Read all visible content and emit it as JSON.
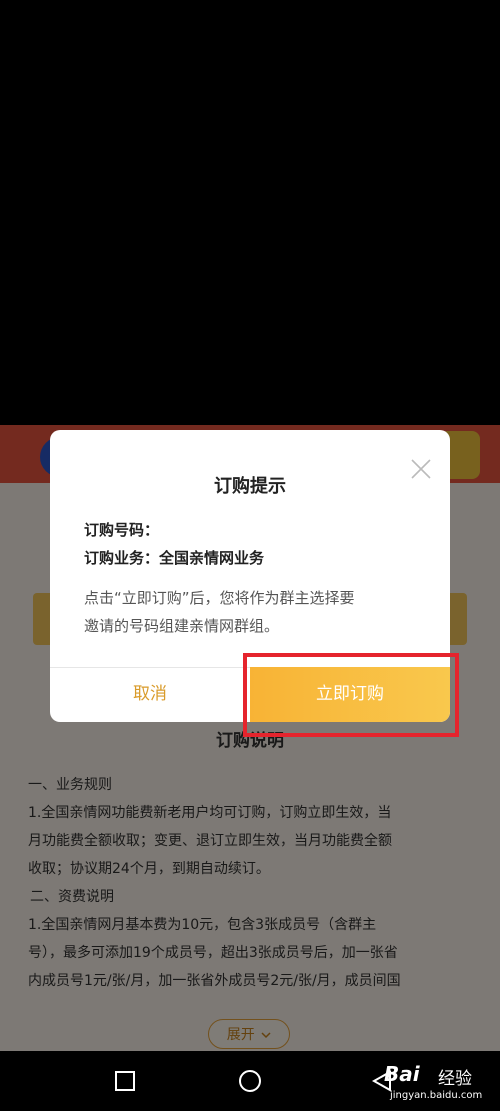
{
  "dialog": {
    "title": "订购提示",
    "number_label": "订购号码：",
    "service_label": "订购业务：全国亲情网业务",
    "message_line1": "点击“立即订购”后，您将作为群主选择要",
    "message_line2": "邀请的号码组建亲情网群组。",
    "cancel_label": "取消",
    "confirm_label": "立即订购"
  },
  "page": {
    "instructions_title": "订购说明",
    "section1_heading": "一、业务规则",
    "section1_lines": [
      "1.全国亲情网功能费新老用户均可订购，订购立即生效，当",
      "月功能费全额收取；变更、退订立即生效，当月功能费全额",
      "收取；协议期24个月，到期自动续订。"
    ],
    "section2_heading": "二、资费说明",
    "section2_lines": [
      "1.全国亲情网月基本费为10元，包含3张成员号（含群主",
      "号），最多可添加19个成员号，超出3张成员号后，加一张省",
      "内成员号1元/张/月，加一张省外成员号2元/张/月，成员间国"
    ],
    "expand_label": "展开"
  },
  "watermark": {
    "logo": "Bai",
    "text": "经验",
    "url": "jingyan.baidu.com"
  },
  "colors": {
    "accent": "#f8b335",
    "highlight": "#e5242d",
    "cancel_text": "#d99b2a"
  },
  "icons": {
    "close": "close-icon",
    "chevron": "chevron-down-icon",
    "recent": "square-icon",
    "home": "circle-icon",
    "back": "triangle-back-icon"
  }
}
